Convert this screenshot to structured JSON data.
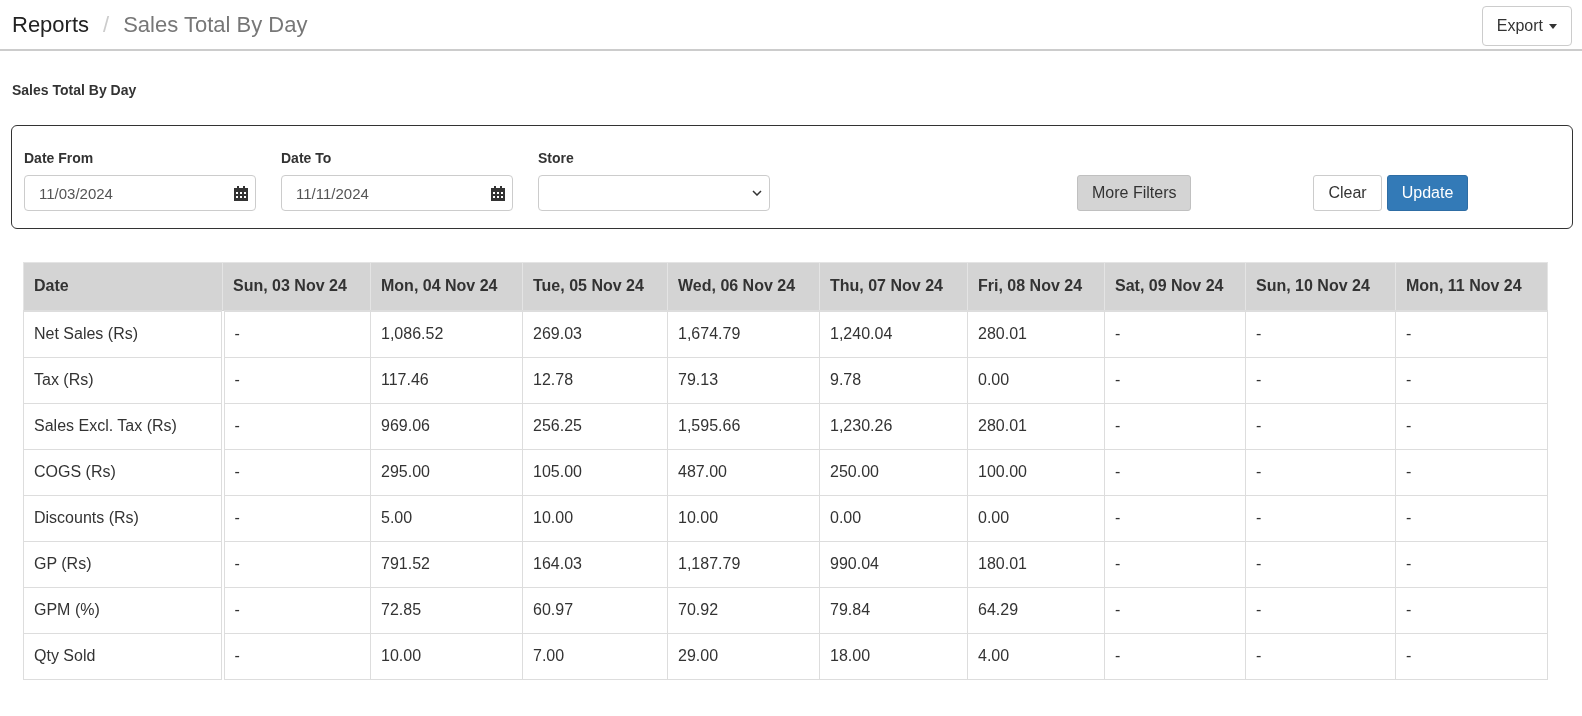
{
  "breadcrumb": {
    "root": "Reports",
    "separator": "/",
    "current": "Sales Total By Day"
  },
  "export_button": {
    "label": "Export"
  },
  "report_title": "Sales Total By Day",
  "filters": {
    "date_from": {
      "label": "Date From",
      "value": "11/03/2024"
    },
    "date_to": {
      "label": "Date To",
      "value": "11/11/2024"
    },
    "store": {
      "label": "Store"
    },
    "more_filters": "More Filters",
    "clear": "Clear",
    "update": "Update"
  },
  "table": {
    "columns": [
      "Date",
      "Sun, 03 Nov 24",
      "Mon, 04 Nov 24",
      "Tue, 05 Nov 24",
      "Wed, 06 Nov 24",
      "Thu, 07 Nov 24",
      "Fri, 08 Nov 24",
      "Sat, 09 Nov 24",
      "Sun, 10 Nov 24",
      "Mon, 11 Nov 24"
    ],
    "rows": [
      [
        "Net Sales (Rs)",
        "-",
        "1,086.52",
        "269.03",
        "1,674.79",
        "1,240.04",
        "280.01",
        "-",
        "-",
        "-"
      ],
      [
        "Tax (Rs)",
        "-",
        "117.46",
        "12.78",
        "79.13",
        "9.78",
        "0.00",
        "-",
        "-",
        "-"
      ],
      [
        "Sales Excl. Tax (Rs)",
        "-",
        "969.06",
        "256.25",
        "1,595.66",
        "1,230.26",
        "280.01",
        "-",
        "-",
        "-"
      ],
      [
        "COGS (Rs)",
        "-",
        "295.00",
        "105.00",
        "487.00",
        "250.00",
        "100.00",
        "-",
        "-",
        "-"
      ],
      [
        "Discounts (Rs)",
        "-",
        "5.00",
        "10.00",
        "10.00",
        "0.00",
        "0.00",
        "-",
        "-",
        "-"
      ],
      [
        "GP (Rs)",
        "-",
        "791.52",
        "164.03",
        "1,187.79",
        "990.04",
        "180.01",
        "-",
        "-",
        "-"
      ],
      [
        "GPM (%)",
        "-",
        "72.85",
        "60.97",
        "70.92",
        "79.84",
        "64.29",
        "-",
        "-",
        "-"
      ],
      [
        "Qty Sold",
        "-",
        "10.00",
        "7.00",
        "29.00",
        "18.00",
        "4.00",
        "-",
        "-",
        "-"
      ]
    ]
  }
}
